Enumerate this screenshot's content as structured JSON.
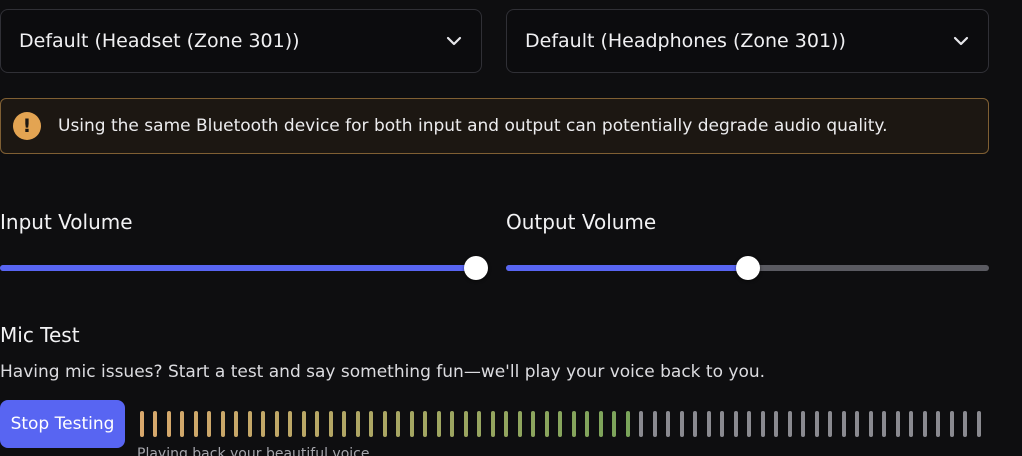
{
  "devices": {
    "input": {
      "selected": "Default (Headset (Zone 301))"
    },
    "output": {
      "selected": "Default (Headphones (Zone 301))"
    }
  },
  "warning": {
    "icon": "exclamation-icon",
    "message": "Using the same Bluetooth device for both input and output can potentially degrade audio quality."
  },
  "volume": {
    "input": {
      "label": "Input Volume",
      "level": 1.0
    },
    "output": {
      "label": "Output Volume",
      "level": 0.5
    }
  },
  "mic_test": {
    "title": "Mic Test",
    "description": "Having mic issues? Start a test and say something fun—we'll play your voice back to you.",
    "button_label": "Stop Testing",
    "status": "Playing back your beautiful voice",
    "meter": {
      "total_bars": 63,
      "active_bars": 37
    }
  },
  "colors": {
    "accent": "#5865f2",
    "warning": "#e3a452",
    "meter_start": "#d9a86c",
    "meter_end": "#7aa45a",
    "meter_inactive": "#8a8a90"
  }
}
